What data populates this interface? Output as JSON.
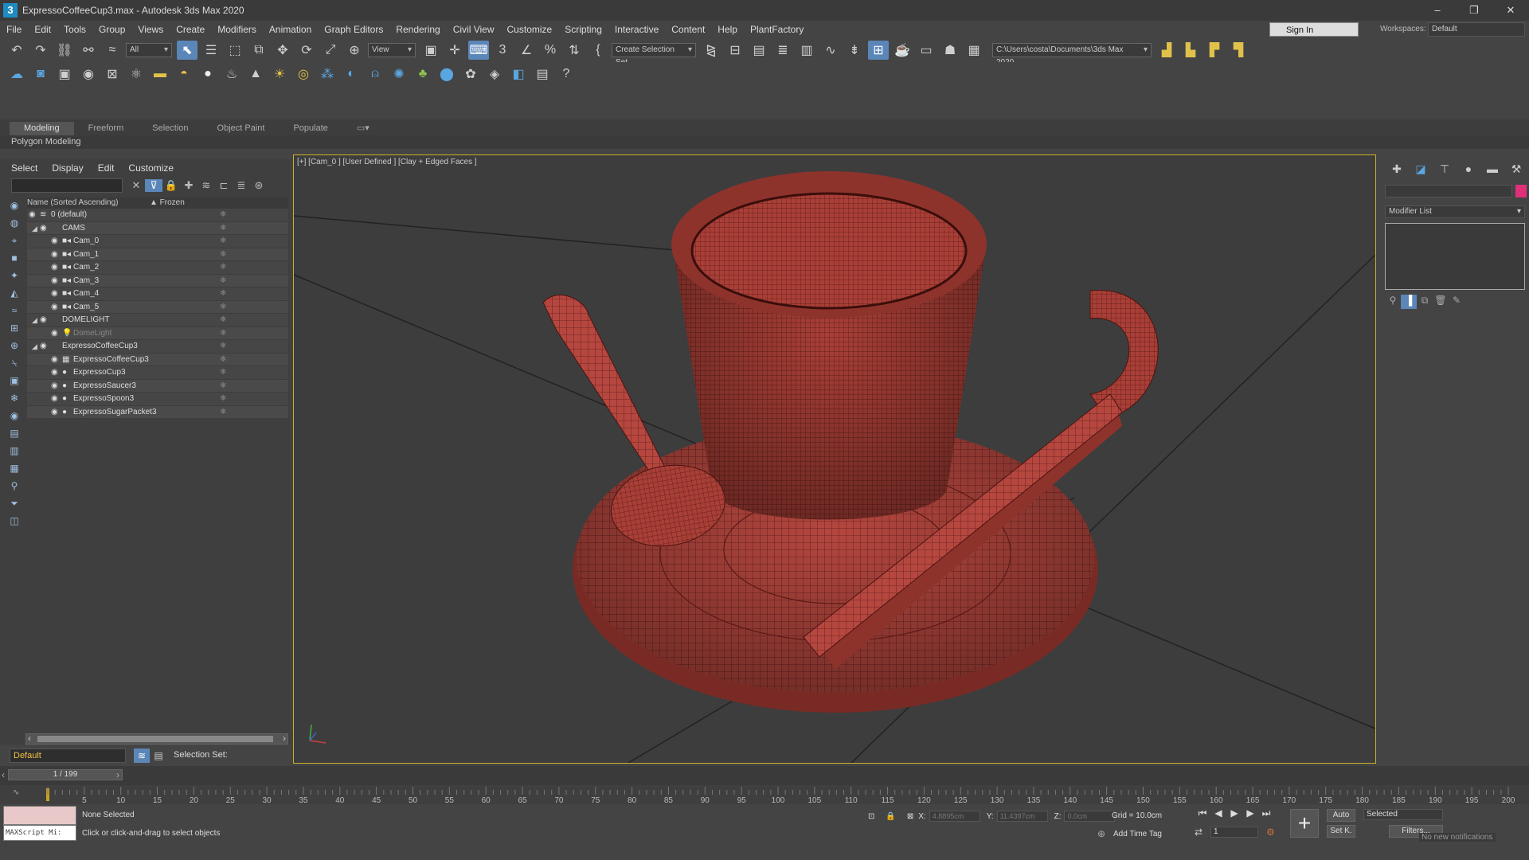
{
  "window": {
    "title": "ExpressoCoffeeCup3.max - Autodesk 3ds Max 2020",
    "app_icon": "3",
    "controls": [
      "–",
      "❐",
      "✕"
    ]
  },
  "menu": [
    "File",
    "Edit",
    "Tools",
    "Group",
    "Views",
    "Create",
    "Modifiers",
    "Animation",
    "Graph Editors",
    "Rendering",
    "Civil View",
    "Customize",
    "Scripting",
    "Interactive",
    "Content",
    "Help",
    "PlantFactory"
  ],
  "signin": "Sign In",
  "workspaces": {
    "label": "Workspaces:",
    "value": "Default"
  },
  "toolbar1": {
    "filter": "All",
    "refcoord": "View",
    "selset": "Create Selection Set",
    "path": "C:\\Users\\costa\\Documents\\3ds Max 2020"
  },
  "ribbon": {
    "tabs": [
      "Modeling",
      "Freeform",
      "Selection",
      "Object Paint",
      "Populate"
    ],
    "sub": "Polygon Modeling"
  },
  "explorer": {
    "menu": [
      "Select",
      "Display",
      "Edit",
      "Customize"
    ],
    "col_name": "Name (Sorted Ascending)",
    "col_frozen": "▲ Frozen",
    "rows": [
      {
        "label": "0 (default)",
        "indent": 0,
        "exp": "",
        "icon": "≋"
      },
      {
        "label": "CAMS",
        "indent": 1,
        "exp": "◢",
        "icon": ""
      },
      {
        "label": "Cam_0",
        "indent": 2,
        "exp": "",
        "icon": "■◂"
      },
      {
        "label": "Cam_1",
        "indent": 2,
        "exp": "",
        "icon": "■◂"
      },
      {
        "label": "Cam_2",
        "indent": 2,
        "exp": "",
        "icon": "■◂"
      },
      {
        "label": "Cam_3",
        "indent": 2,
        "exp": "",
        "icon": "■◂"
      },
      {
        "label": "Cam_4",
        "indent": 2,
        "exp": "",
        "icon": "■◂"
      },
      {
        "label": "Cam_5",
        "indent": 2,
        "exp": "",
        "icon": "■◂"
      },
      {
        "label": "DOMELIGHT",
        "indent": 1,
        "exp": "◢",
        "icon": ""
      },
      {
        "label": "DomeLight",
        "indent": 2,
        "exp": "",
        "icon": "💡",
        "dim": true
      },
      {
        "label": "ExpressoCoffeeCup3",
        "indent": 1,
        "exp": "◢",
        "icon": ""
      },
      {
        "label": "ExpressoCoffeeCup3",
        "indent": 2,
        "exp": "",
        "icon": "▦"
      },
      {
        "label": "ExpressoCup3",
        "indent": 2,
        "exp": "",
        "icon": "●"
      },
      {
        "label": "ExpressoSaucer3",
        "indent": 2,
        "exp": "",
        "icon": "●"
      },
      {
        "label": "ExpressoSpoon3",
        "indent": 2,
        "exp": "",
        "icon": "●"
      },
      {
        "label": "ExpressoSugarPacket3",
        "indent": 2,
        "exp": "",
        "icon": "●"
      }
    ]
  },
  "layer": {
    "value": "Default",
    "selset": "Selection Set:"
  },
  "viewport": {
    "label": "[+] [Cam_0 ] [User Defined ] [Clay + Edged Faces ]"
  },
  "cmd": {
    "modlist": "Modifier List"
  },
  "frame": {
    "counter": "1 / 199"
  },
  "timeline": {
    "ticks": [
      "5",
      "10",
      "15",
      "20",
      "25",
      "30",
      "35",
      "40",
      "45",
      "50",
      "55",
      "60",
      "65",
      "70",
      "75",
      "80",
      "85",
      "90",
      "95",
      "100",
      "105",
      "110",
      "115",
      "120",
      "125",
      "130",
      "135",
      "140",
      "145",
      "150",
      "155",
      "160",
      "165",
      "170",
      "175",
      "180",
      "185",
      "190",
      "195",
      "200"
    ]
  },
  "status": {
    "script": "MAXScript Mi:",
    "selection": "None Selected",
    "hint": "Click or click-and-drag to select objects",
    "x_label": "X:",
    "x": "4.8895cm",
    "y_label": "Y:",
    "y": "11.4397cm",
    "z_label": "Z:",
    "z": "0.0cm",
    "grid": "Grid = 10.0cm",
    "addtime": "Add Time Tag",
    "auto": "Auto",
    "setk": "Set K.",
    "selected": "Selected",
    "filters": "Filters...",
    "frame_value": "1",
    "notif": "No new notifications"
  },
  "colors": {
    "accent": "#5b86b8",
    "viewport_border": "#c9b02a",
    "mesh": "#b5473f",
    "wire": "#5a1a16"
  }
}
